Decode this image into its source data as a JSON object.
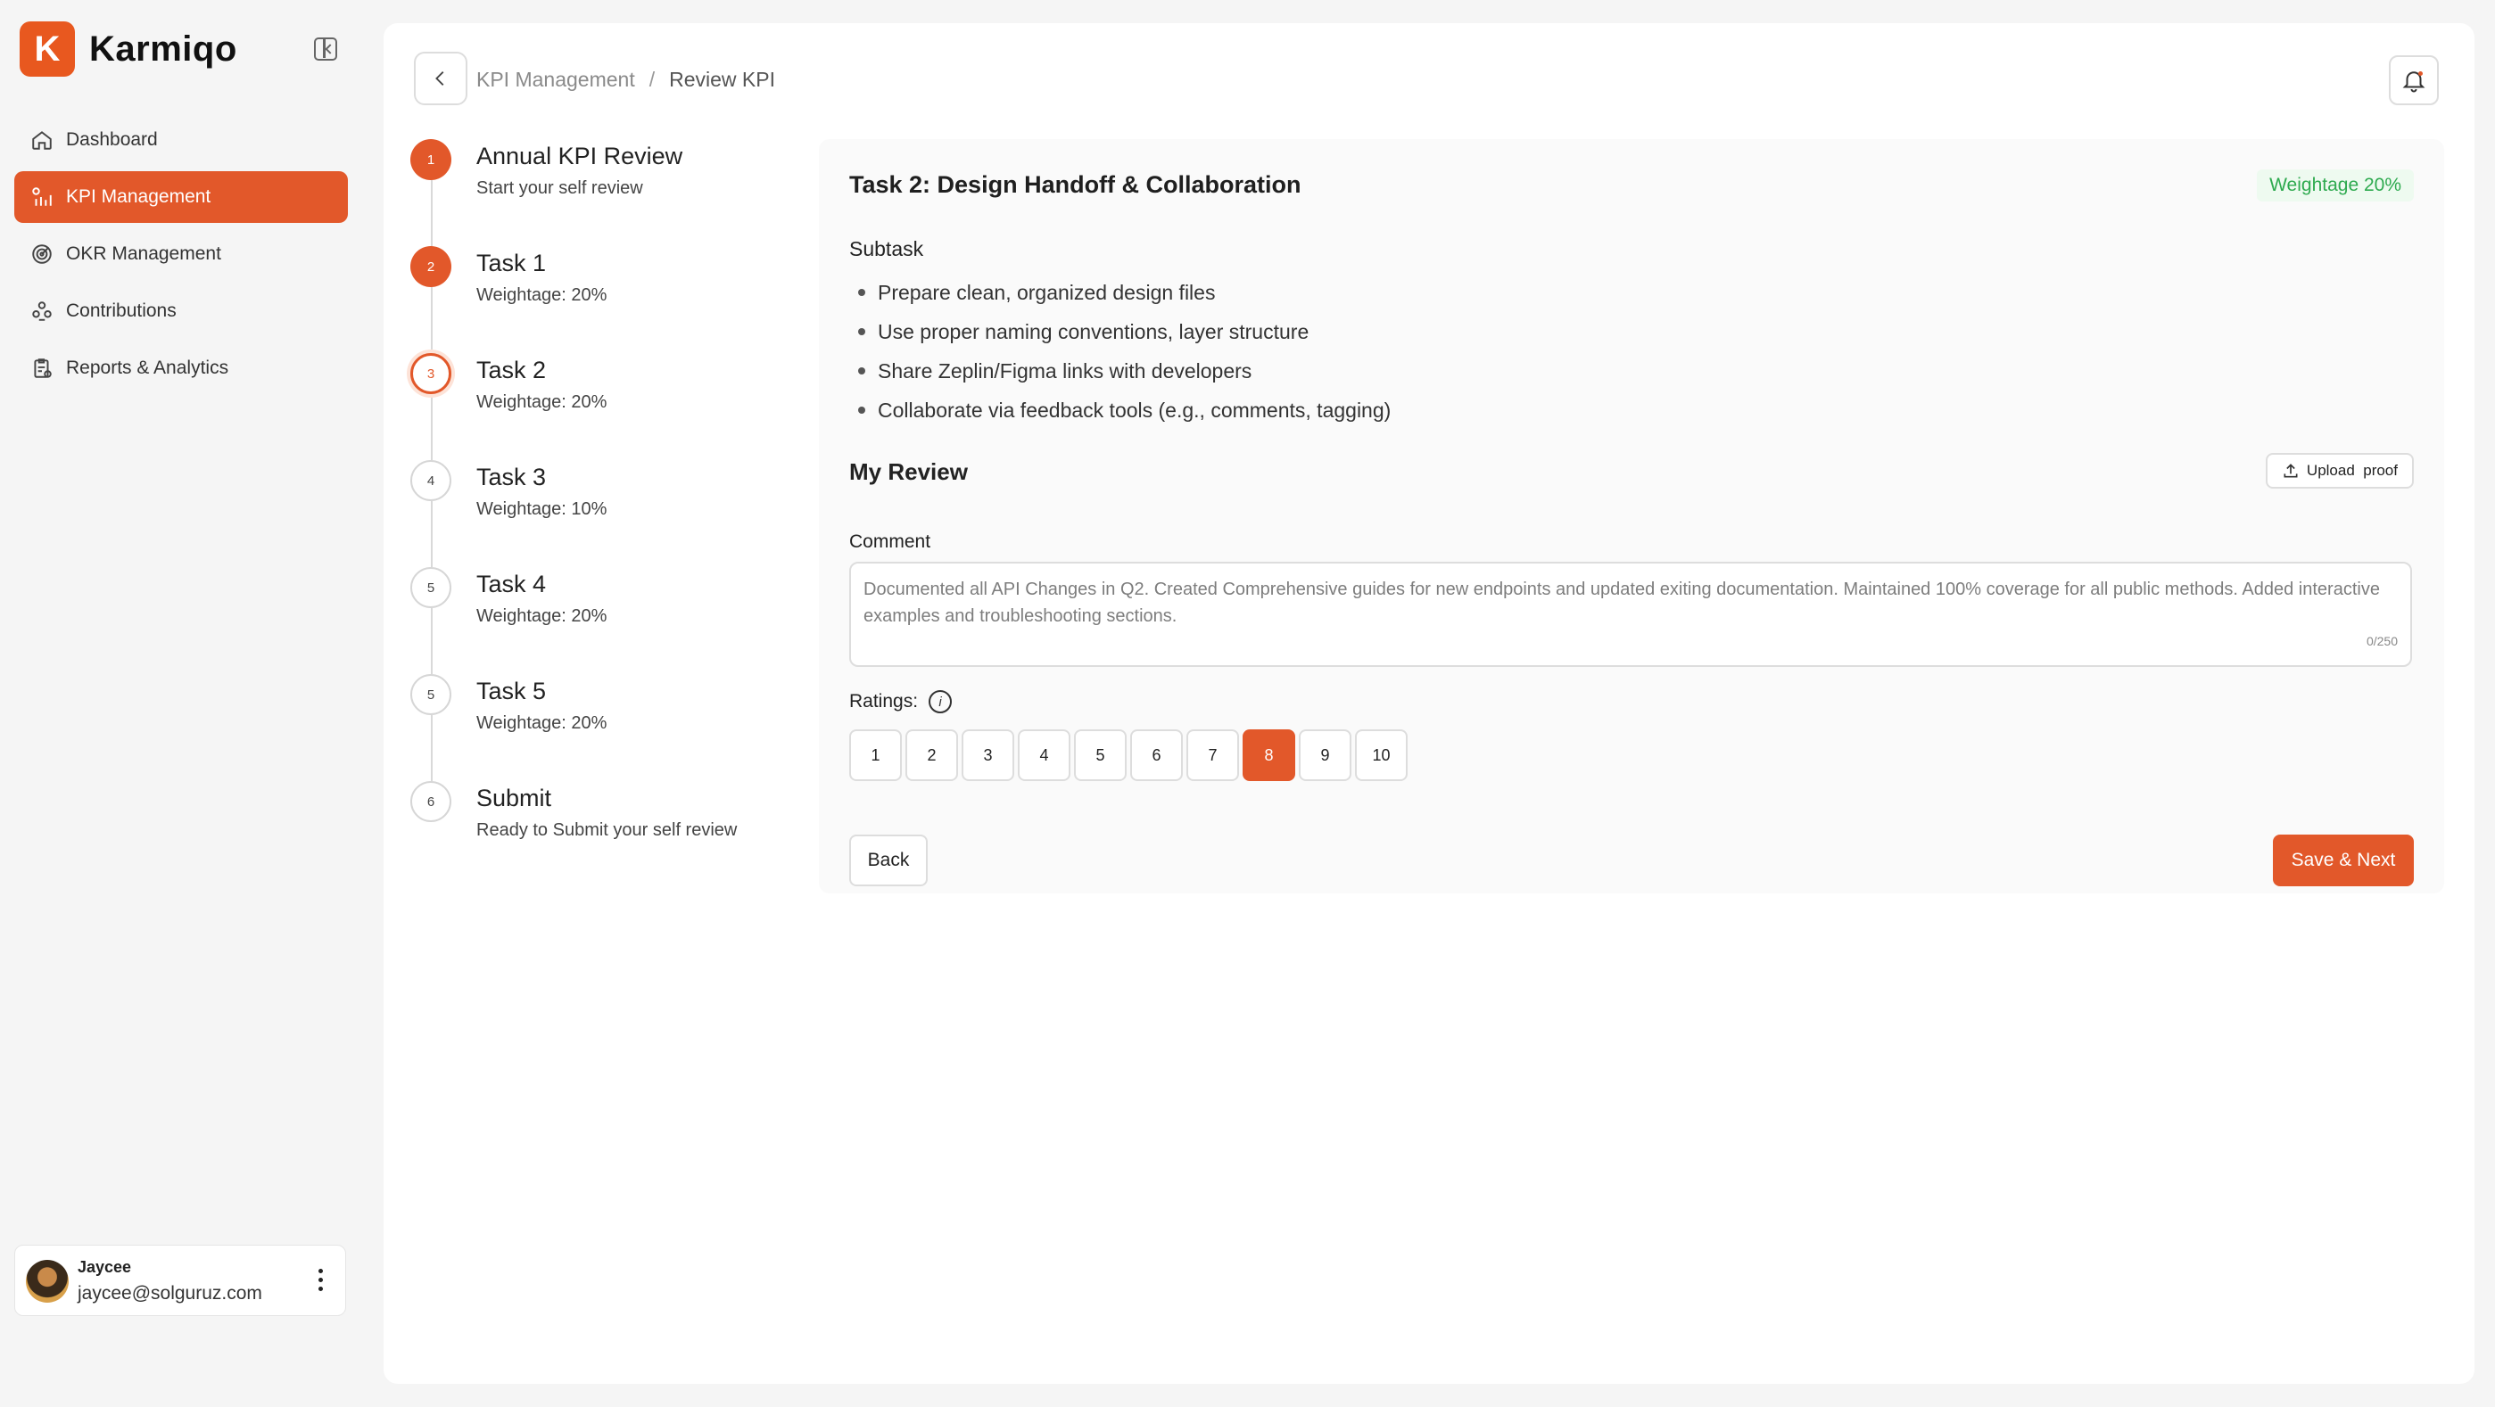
{
  "brand": {
    "logo_letter": "K",
    "name": "Karmiqo",
    "accent": "#e2582a"
  },
  "sidebar": {
    "items": [
      {
        "label": "Dashboard",
        "icon": "home-icon",
        "active": false
      },
      {
        "label": "KPI Management",
        "icon": "kpi-chart-icon",
        "active": true
      },
      {
        "label": "OKR Management",
        "icon": "target-icon",
        "active": false
      },
      {
        "label": "Contributions",
        "icon": "people-icon",
        "active": false
      },
      {
        "label": "Reports & Analytics",
        "icon": "report-icon",
        "active": false
      }
    ],
    "user": {
      "name": "Jaycee",
      "email": "jaycee@solguruz.com"
    }
  },
  "header": {
    "breadcrumb": [
      "KPI Management",
      "Review KPI"
    ],
    "separator": "/"
  },
  "stepper": [
    {
      "num": "1",
      "title": "Annual KPI Review",
      "subtitle": "Start your self review",
      "state": "done"
    },
    {
      "num": "2",
      "title": "Task 1",
      "subtitle": "Weightage: 20%",
      "state": "done"
    },
    {
      "num": "3",
      "title": "Task 2",
      "subtitle": "Weightage: 20%",
      "state": "current"
    },
    {
      "num": "4",
      "title": "Task 3",
      "subtitle": "Weightage: 10%",
      "state": "todo"
    },
    {
      "num": "5",
      "title": "Task 4",
      "subtitle": "Weightage: 20%",
      "state": "todo"
    },
    {
      "num": "5",
      "title": "Task 5",
      "subtitle": "Weightage: 20%",
      "state": "todo"
    },
    {
      "num": "6",
      "title": "Submit",
      "subtitle": "Ready to Submit your self review",
      "state": "todo"
    }
  ],
  "task": {
    "title": "Task 2: Design Handoff & Collaboration",
    "weightage_badge": "Weightage 20%",
    "subtask_label": "Subtask",
    "subtasks": [
      "Prepare clean, organized design files",
      "Use proper naming conventions, layer structure",
      "Share Zeplin/Figma links with developers",
      "Collaborate via feedback tools (e.g., comments, tagging)"
    ]
  },
  "review": {
    "title": "My Review",
    "upload_label": "Upload  proof",
    "comment_label": "Comment",
    "comment_text": "Documented all API Changes in Q2. Created Comprehensive guides for new endpoints and updated exiting documentation. Maintained 100% coverage for all public methods. Added interactive examples and troubleshooting sections.",
    "counter": "0/250",
    "ratings_label": "Ratings:",
    "ratings": [
      "1",
      "2",
      "3",
      "4",
      "5",
      "6",
      "7",
      "8",
      "9",
      "10"
    ],
    "selected_rating": "8"
  },
  "actions": {
    "back": "Back",
    "save_next": "Save & Next"
  }
}
